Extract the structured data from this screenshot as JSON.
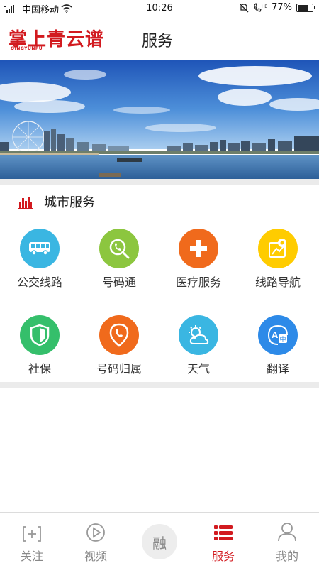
{
  "status_bar": {
    "carrier": "中国移动",
    "time": "10:26",
    "battery": "77%",
    "battery_level": 0.77
  },
  "header": {
    "logo_text": "掌上青云谱",
    "logo_subtext": "QINGYUNPU",
    "title": "服务"
  },
  "section": {
    "title": "城市服务"
  },
  "services": [
    {
      "label": "公交线路",
      "icon": "bus-icon",
      "color": "#3ab6e2"
    },
    {
      "label": "号码通",
      "icon": "phone-search-icon",
      "color": "#8cc63f"
    },
    {
      "label": "医疗服务",
      "icon": "medical-cross-icon",
      "color": "#f06a1c"
    },
    {
      "label": "线路导航",
      "icon": "map-navigation-icon",
      "color": "#ffcc00"
    },
    {
      "label": "社保",
      "icon": "shield-icon",
      "color": "#35bf6b"
    },
    {
      "label": "号码归属",
      "icon": "phone-location-icon",
      "color": "#f06a1c"
    },
    {
      "label": "天气",
      "icon": "weather-icon",
      "color": "#3ab6e2"
    },
    {
      "label": "翻译",
      "icon": "translate-icon",
      "color": "#2d8ae8"
    }
  ],
  "tabs": [
    {
      "label": "关注",
      "icon": "add-follow-icon",
      "active": false
    },
    {
      "label": "视频",
      "icon": "play-icon",
      "active": false
    },
    {
      "label": "融",
      "icon": "fusion-icon",
      "active": false
    },
    {
      "label": "服务",
      "icon": "list-icon",
      "active": true
    },
    {
      "label": "我的",
      "icon": "user-icon",
      "active": false
    }
  ],
  "colors": {
    "brand_red": "#d21a1f",
    "tab_inactive": "#888888"
  }
}
